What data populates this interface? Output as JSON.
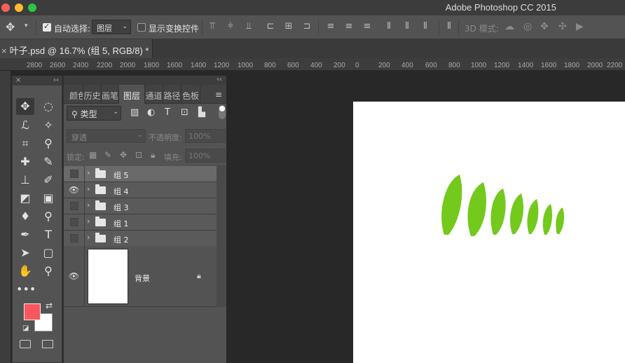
{
  "app": {
    "title": "Adobe Photoshop CC 2015"
  },
  "options_bar": {
    "auto_select_label": "自动选择:",
    "auto_select_checked": true,
    "auto_select_target": "图层",
    "show_transform_label": "显示变换控件",
    "show_transform_checked": false,
    "mode_3d_label": "3D 模式:"
  },
  "document": {
    "tab_close": "×",
    "tab_title": "叶子.psd @ 16.7% (组 5, RGB/8) *"
  },
  "ruler": {
    "labels": [
      "2800",
      "2600",
      "2400",
      "2200",
      "2000",
      "1800",
      "1600",
      "1400",
      "1200",
      "1000",
      "800",
      "600",
      "400",
      "200",
      "0",
      "200",
      "400",
      "600",
      "800",
      "1000",
      "1200",
      "1400",
      "1600",
      "1800",
      "2000",
      "2200"
    ]
  },
  "toolbox": {
    "close": "×",
    "collapse": "‹‹",
    "foreground_color": "#f8575d",
    "background_color": "#ffffff",
    "more_tools": "•••"
  },
  "panel": {
    "collapse": "‹‹",
    "tabs": [
      "颜色",
      "历史",
      "画笔",
      "图层",
      "通道",
      "路径",
      "色板"
    ],
    "active_tab": "图层",
    "menu_icon": "≡",
    "filter_label": "类型",
    "blend_mode": "穿透",
    "opacity_label": "不透明度:",
    "opacity_value": "100%",
    "lock_label": "锁定:",
    "fill_label": "填充:",
    "fill_value": "100%"
  },
  "layers": [
    {
      "name": "组 5",
      "visible": false,
      "selected": true
    },
    {
      "name": "组 4",
      "visible": true,
      "selected": false
    },
    {
      "name": "组 3",
      "visible": false,
      "selected": false
    },
    {
      "name": "组 1",
      "visible": false,
      "selected": false
    },
    {
      "name": "组 2",
      "visible": false,
      "selected": false
    }
  ],
  "background_layer": {
    "name": "背景",
    "visible": true,
    "locked": true
  },
  "canvas": {
    "leaf_color": "#73c91c",
    "background": "#ffffff"
  }
}
